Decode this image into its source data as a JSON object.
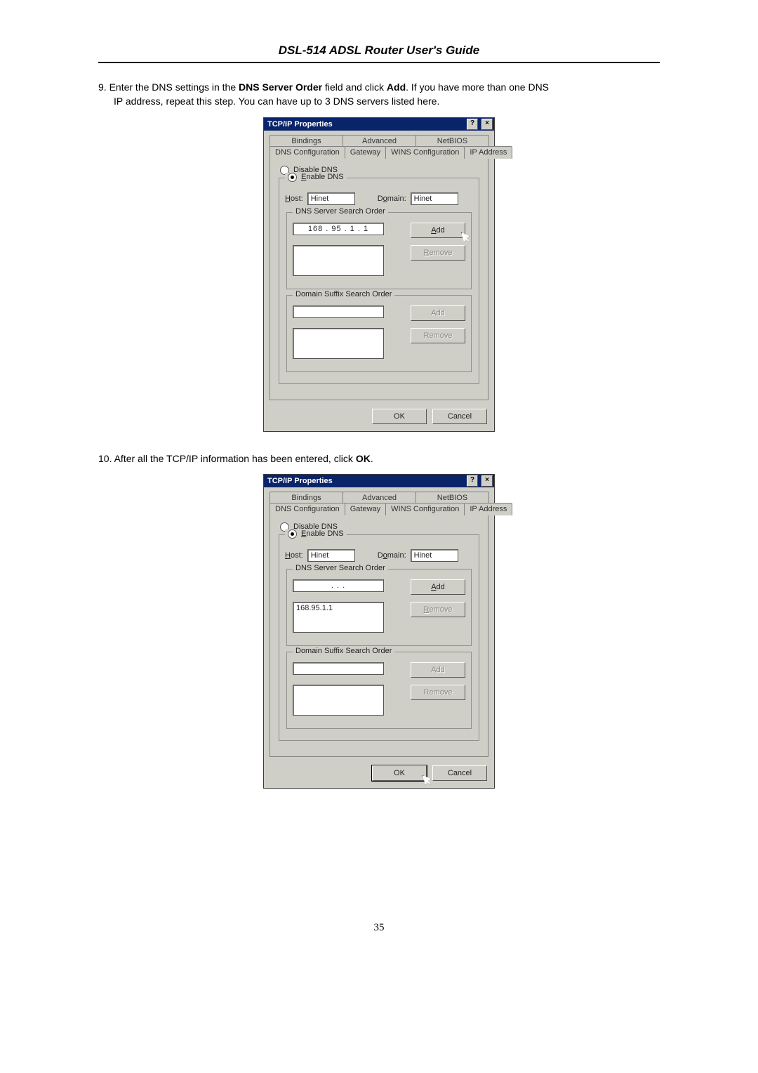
{
  "header": {
    "title": "DSL-514 ADSL Router User's Guide"
  },
  "steps": {
    "s9": {
      "num": "9.",
      "pre": "Enter the DNS settings in the ",
      "b1": "DNS Server Order",
      "mid": " field and click ",
      "b2": "Add",
      "post1": ". If you have more than one DNS",
      "post2": "IP address, repeat this step. You can have up to 3 DNS servers listed here."
    },
    "s10": {
      "num": "10.",
      "pre": "After all the TCP/IP information has been entered, click ",
      "b1": "OK",
      "post": "."
    }
  },
  "dialog": {
    "title": "TCP/IP Properties",
    "help_icon": "?",
    "close_icon": "×",
    "tabs_row1": {
      "t1": "Bindings",
      "t2": "Advanced",
      "t3": "NetBIOS"
    },
    "tabs_row2": {
      "t1": "DNS Configuration",
      "t2": "Gateway",
      "t3": "WINS Configuration",
      "t4": "IP Address"
    },
    "disable_label_pre": "D",
    "disable_label_u": "i",
    "disable_label_post": "sable DNS",
    "enable_label_u": "E",
    "enable_label_post": "nable DNS",
    "host_u": "H",
    "host_post": "ost:",
    "host_val": "Hinet",
    "domain_pre": "D",
    "domain_u": "o",
    "domain_post": "main:",
    "domain_val": "Hinet",
    "dns_group": "DNS Server Search Order",
    "domain_group": "Domain Suffix Search Order",
    "add_u": "A",
    "add_post": "dd",
    "remove_u": "R",
    "remove_post": "emove",
    "ok": "OK",
    "cancel": "Cancel"
  },
  "dlg1": {
    "ip_value": "168 . 95 .  1  .  1",
    "list_entry": ""
  },
  "dlg2": {
    "ip_value": ".       .       .",
    "list_entry": "168.95.1.1"
  },
  "page_number": "35"
}
